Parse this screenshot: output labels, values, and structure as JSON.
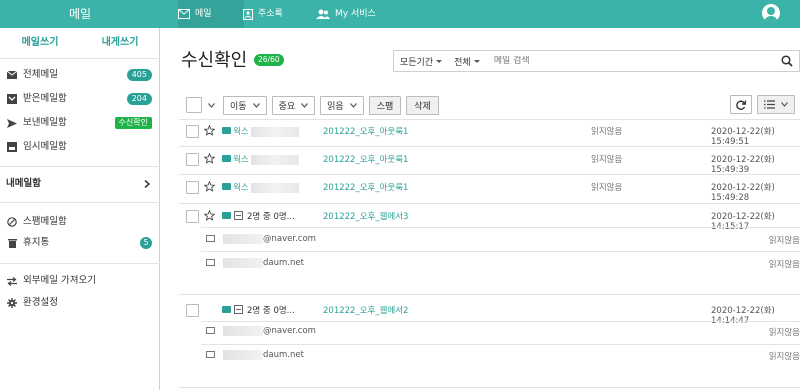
{
  "topbar": {
    "brand": "메일",
    "nav": [
      {
        "label": "메일",
        "icon": "mail-icon"
      },
      {
        "label": "주소록",
        "icon": "contacts-icon"
      },
      {
        "label": "My 서비스",
        "icon": "user-group-icon"
      }
    ],
    "avatar_icon": "account-icon"
  },
  "sidebar": {
    "compose": "메일쓰기",
    "self_compose": "내게쓰기",
    "folders": [
      {
        "label": "전체메일",
        "badge": "405",
        "icon": "mail-icon"
      },
      {
        "label": "받은메일함",
        "badge": "204",
        "icon": "inbox-icon"
      },
      {
        "label": "보낸메일함",
        "badge": "수신확인",
        "icon": "send-icon"
      },
      {
        "label": "임시메일함",
        "icon": "draft-icon"
      }
    ],
    "my_mailbox": "내메일함",
    "others": [
      {
        "label": "스팸메일함",
        "icon": "spam-icon"
      },
      {
        "label": "휴지통",
        "badge": "5",
        "icon": "trash-icon"
      }
    ],
    "bottom": [
      {
        "label": "외부메일 가져오기",
        "icon": "import-icon"
      },
      {
        "label": "환경설정",
        "icon": "gear-icon"
      }
    ]
  },
  "main": {
    "title": "수신확인",
    "count": "26/60",
    "search": {
      "period": "모든기간",
      "scope": "전체",
      "placeholder": "메일 검색"
    },
    "toolbar": {
      "move": "이동",
      "important": "중요",
      "read": "읽음",
      "spam": "스팸",
      "delete": "삭제"
    },
    "rows": [
      {
        "sender": "웍스",
        "subject": "201222_오후_아웃룩1",
        "status": "읽지않음",
        "date": "2020-12-22(화)",
        "time": "15:49:51"
      },
      {
        "sender": "웍스",
        "subject": "201222_오후_아웃룩1",
        "status": "읽지않음",
        "date": "2020-12-22(화)",
        "time": "15:49:39"
      },
      {
        "sender": "웍스",
        "subject": "201222_오후_아웃룩1",
        "status": "읽지않음",
        "date": "2020-12-22(화)",
        "time": "15:49:28"
      }
    ],
    "groups": [
      {
        "sender": "2명 중 0명...",
        "subject": "201222_오후_웹에서3",
        "date": "2020-12-22(화)",
        "time": "14:15:17",
        "recipients": [
          {
            "addr": "@naver.com",
            "status": "읽지않음"
          },
          {
            "addr": "daum.net",
            "status": "읽지않음"
          }
        ]
      },
      {
        "sender": "2명 중 0명...",
        "subject": "201222_오후_웹에서2",
        "date": "2020-12-22(화)",
        "time": "14:14:47",
        "recipients": [
          {
            "addr": "@naver.com",
            "status": "읽지않음"
          },
          {
            "addr": "daum.net",
            "status": "읽지않음"
          }
        ]
      }
    ]
  }
}
